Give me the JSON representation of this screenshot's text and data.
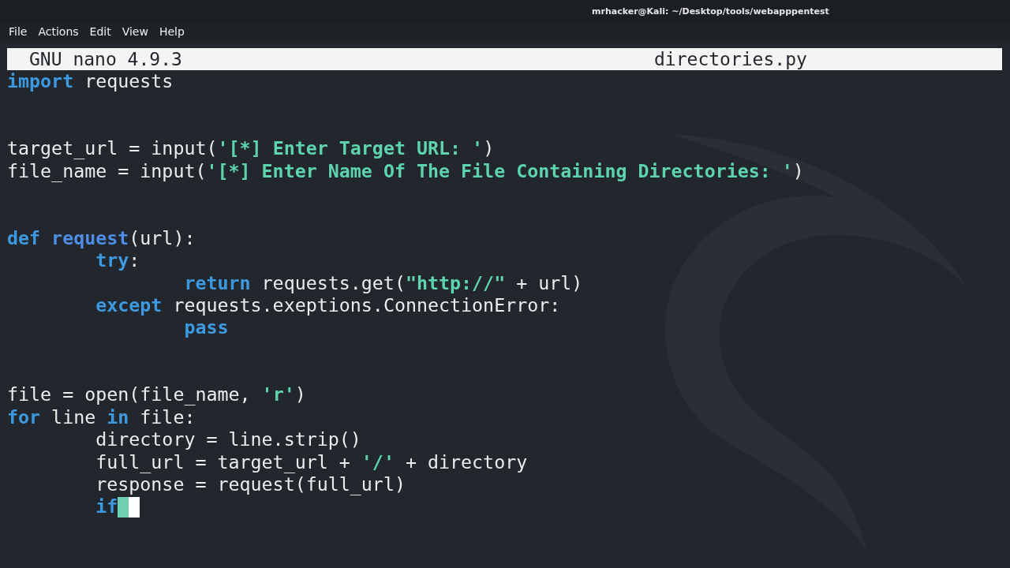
{
  "window": {
    "title": "mrhacker@Kali: ~/Desktop/tools/webapppentest"
  },
  "menu": [
    "File",
    "Actions",
    "Edit",
    "View",
    "Help"
  ],
  "nano": {
    "version": "GNU nano 4.9.3",
    "filename": "directories.py"
  },
  "lines": [
    {
      "kind": "code",
      "tokens": [
        {
          "kind": "keyword",
          "text": "import"
        },
        {
          "kind": "plain",
          "text": " requests"
        }
      ]
    },
    {
      "kind": "blank"
    },
    {
      "kind": "blank"
    },
    {
      "kind": "code",
      "tokens": [
        {
          "kind": "plain",
          "text": "target_url = input("
        },
        {
          "kind": "string",
          "text": "'[*] Enter Target URL: '"
        },
        {
          "kind": "plain",
          "text": ")"
        }
      ]
    },
    {
      "kind": "code",
      "tokens": [
        {
          "kind": "plain",
          "text": "file_name = input("
        },
        {
          "kind": "string",
          "text": "'[*] Enter Name Of The File Containing Directories: '"
        },
        {
          "kind": "plain",
          "text": ")"
        }
      ]
    },
    {
      "kind": "blank"
    },
    {
      "kind": "blank"
    },
    {
      "kind": "code",
      "tokens": [
        {
          "kind": "keyword",
          "text": "def"
        },
        {
          "kind": "function",
          "text": " request"
        },
        {
          "kind": "plain",
          "text": "(url):"
        }
      ],
      "children": [
        {
          "kind": "code",
          "tokens": [
            {
              "kind": "keyword",
              "text": "try"
            },
            {
              "kind": "plain",
              "text": ":"
            }
          ],
          "children": [
            {
              "kind": "code",
              "tokens": [
                {
                  "kind": "keyword",
                  "text": "return"
                },
                {
                  "kind": "plain",
                  "text": " requests.get("
                },
                {
                  "kind": "string",
                  "text": "\"http://\""
                },
                {
                  "kind": "plain",
                  "text": " + url)"
                }
              ]
            }
          ]
        },
        {
          "kind": "code",
          "tokens": [
            {
              "kind": "keyword",
              "text": "except"
            },
            {
              "kind": "plain",
              "text": " requests.exeptions.ConnectionError:"
            }
          ],
          "children": [
            {
              "kind": "code",
              "tokens": [
                {
                  "kind": "keyword",
                  "text": "pass"
                }
              ]
            }
          ]
        }
      ]
    },
    {
      "kind": "blank"
    },
    {
      "kind": "blank"
    },
    {
      "kind": "code",
      "tokens": [
        {
          "kind": "plain",
          "text": "file = open(file_name, "
        },
        {
          "kind": "string",
          "text": "'r'"
        },
        {
          "kind": "plain",
          "text": ")"
        }
      ]
    },
    {
      "kind": "code",
      "tokens": [
        {
          "kind": "keyword",
          "text": "for"
        },
        {
          "kind": "plain",
          "text": " line "
        },
        {
          "kind": "keyword",
          "text": "in"
        },
        {
          "kind": "plain",
          "text": " file:"
        }
      ],
      "children": [
        {
          "kind": "code",
          "tokens": [
            {
              "kind": "plain",
              "text": "directory = line.strip()"
            }
          ]
        },
        {
          "kind": "code",
          "tokens": [
            {
              "kind": "plain",
              "text": "full_url = target_url + "
            },
            {
              "kind": "string",
              "text": "'/'"
            },
            {
              "kind": "plain",
              "text": " + directory"
            }
          ]
        },
        {
          "kind": "code",
          "tokens": [
            {
              "kind": "plain",
              "text": "response = request(full_url)"
            }
          ]
        },
        {
          "kind": "code",
          "cursor": true,
          "tokens": [
            {
              "kind": "keyword",
              "text": "if"
            }
          ]
        }
      ]
    }
  ]
}
